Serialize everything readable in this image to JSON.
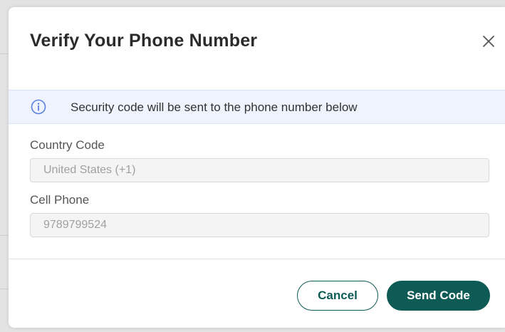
{
  "dialog": {
    "title": "Verify Your Phone Number",
    "close_icon": "close-icon"
  },
  "banner": {
    "icon": "info-icon",
    "text": "Security code will be sent to the phone number below"
  },
  "fields": {
    "country_code": {
      "label": "Country Code",
      "value": "United States (+1)"
    },
    "cell_phone": {
      "label": "Cell Phone",
      "value": "9789799524"
    }
  },
  "actions": {
    "cancel_label": "Cancel",
    "send_label": "Send Code"
  },
  "colors": {
    "accent": "#0e5a55",
    "banner_bg": "#eef3fd",
    "info_icon": "#5b7fe0"
  }
}
